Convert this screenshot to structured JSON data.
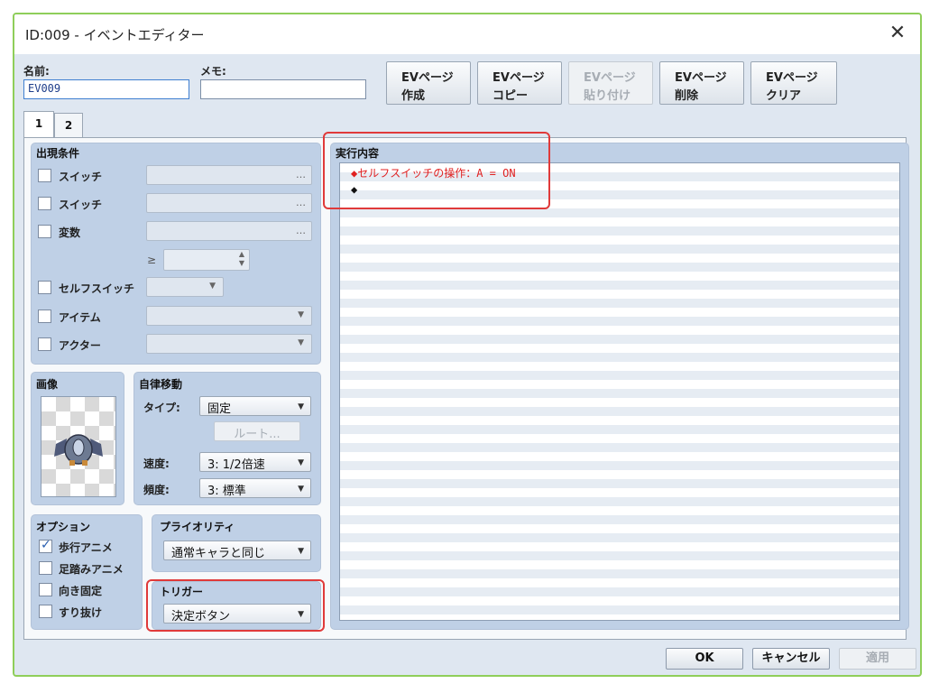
{
  "window": {
    "title": "ID:009 - イベントエディター"
  },
  "fields": {
    "name_label": "名前:",
    "name_value": "EV009",
    "memo_label": "メモ:",
    "memo_value": ""
  },
  "toolbar": [
    {
      "l1": "EVページ",
      "l2": "作成",
      "enabled": true
    },
    {
      "l1": "EVページ",
      "l2": "コピー",
      "enabled": true
    },
    {
      "l1": "EVページ",
      "l2": "貼り付け",
      "enabled": false
    },
    {
      "l1": "EVページ",
      "l2": "削除",
      "enabled": true
    },
    {
      "l1": "EVページ",
      "l2": "クリア",
      "enabled": true
    }
  ],
  "tabs": [
    "1",
    "2"
  ],
  "conditions": {
    "title": "出現条件",
    "switch1": "スイッチ",
    "switch2": "スイッチ",
    "variable": "変数",
    "gte": "≥",
    "self_switch": "セルフスイッチ",
    "item": "アイテム",
    "actor": "アクター",
    "dots": "…"
  },
  "image": {
    "title": "画像"
  },
  "movement": {
    "title": "自律移動",
    "type_label": "タイプ:",
    "type_value": "固定",
    "route_button": "ルート...",
    "speed_label": "速度:",
    "speed_value": "3: 1/2倍速",
    "freq_label": "頻度:",
    "freq_value": "3: 標準"
  },
  "options": {
    "title": "オプション",
    "walk_anim": "歩行アニメ",
    "walk_checked": true,
    "step_anim": "足踏みアニメ",
    "dir_fix": "向き固定",
    "through": "すり抜け"
  },
  "priority": {
    "title": "プライオリティ",
    "value": "通常キャラと同じ"
  },
  "trigger": {
    "title": "トリガー",
    "value": "決定ボタン"
  },
  "contents": {
    "title": "実行内容",
    "line1": "◆セルフスイッチの操作：A = ON",
    "line2": "◆"
  },
  "footer": {
    "ok": "OK",
    "cancel": "キャンセル",
    "apply": "適用"
  },
  "colors": {
    "accent_red": "#e03a3a",
    "command_red": "#e02020",
    "panel_blue": "#bfd0e6"
  }
}
